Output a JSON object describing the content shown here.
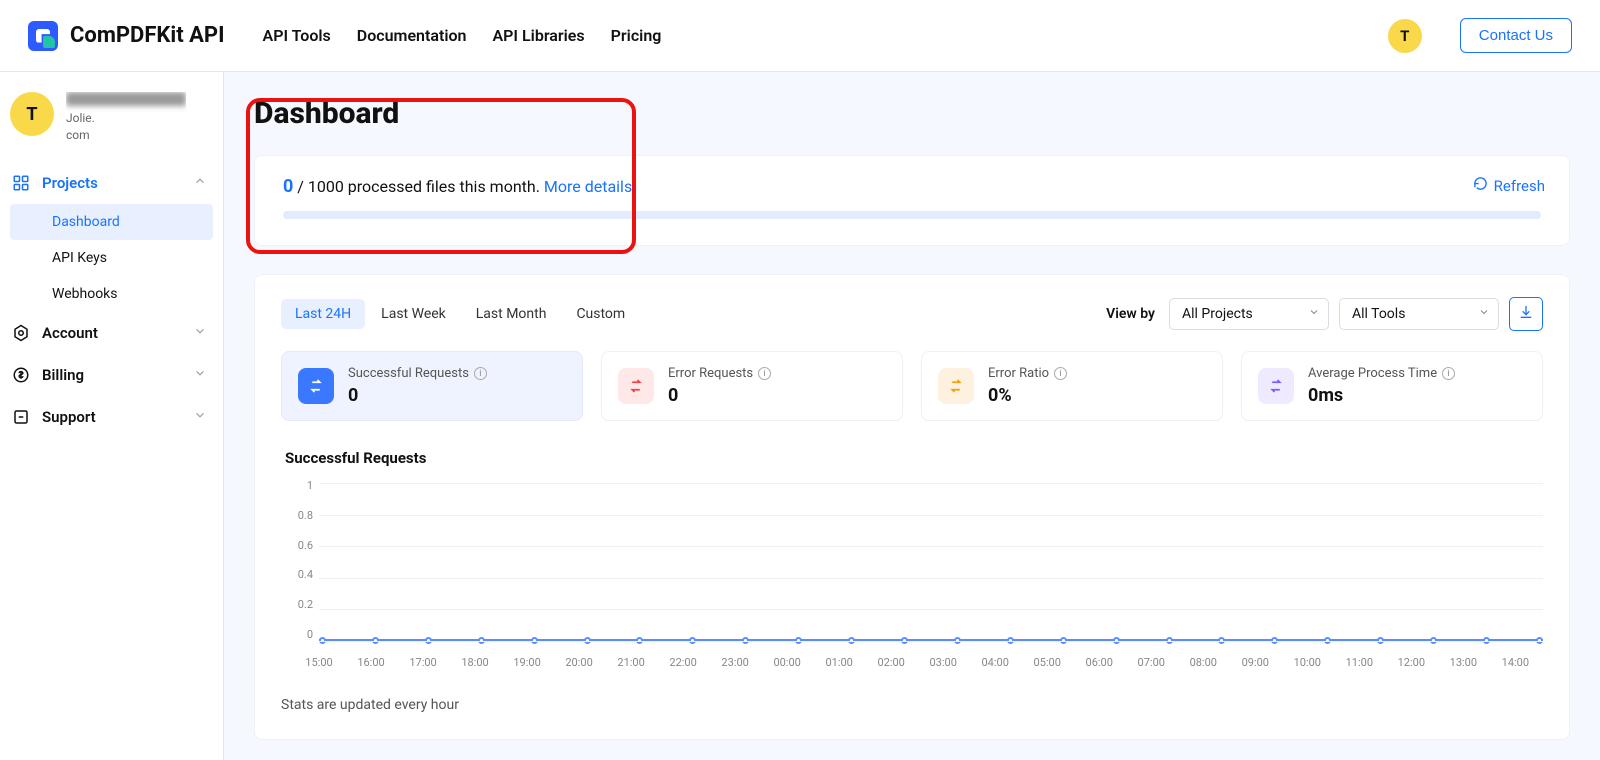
{
  "brand": "ComPDFKit API",
  "nav": {
    "api_tools": "API Tools",
    "documentation": "Documentation",
    "api_libraries": "API Libraries",
    "pricing": "Pricing",
    "contact": "Contact Us"
  },
  "avatar_letter": "T",
  "sidebar": {
    "user_line2": "  Jolie.",
    "user_line3": "com",
    "projects": {
      "label": "Projects",
      "items": [
        {
          "label": "Dashboard"
        },
        {
          "label": "API Keys"
        },
        {
          "label": "Webhooks"
        }
      ]
    },
    "account": {
      "label": "Account"
    },
    "billing": {
      "label": "Billing"
    },
    "support": {
      "label": "Support"
    }
  },
  "page": {
    "title": "Dashboard",
    "usage": {
      "processed": "0",
      "limit_text": " / 1000 processed files this month. ",
      "more_details": "More details",
      "refresh": "Refresh"
    },
    "range_tabs": [
      "Last 24H",
      "Last Week",
      "Last Month",
      "Custom"
    ],
    "active_range_index": 0,
    "view_by_label": "View by",
    "project_select": "All Projects",
    "tool_select": "All Tools",
    "metrics": [
      {
        "label": "Successful Requests",
        "value": "0"
      },
      {
        "label": "Error Requests",
        "value": "0"
      },
      {
        "label": "Error Ratio",
        "value": "0%"
      },
      {
        "label": "Average Process Time",
        "value": "0ms"
      }
    ],
    "chart_title": "Successful Requests",
    "chart_footer": "Stats are updated every hour"
  },
  "chart_data": {
    "type": "line",
    "title": "Successful Requests",
    "xlabel": "",
    "ylabel": "",
    "ylim": [
      0,
      1
    ],
    "yticks": [
      0,
      0.2,
      0.4,
      0.6,
      0.8,
      1
    ],
    "categories": [
      "15:00",
      "16:00",
      "17:00",
      "18:00",
      "19:00",
      "20:00",
      "21:00",
      "22:00",
      "23:00",
      "00:00",
      "01:00",
      "02:00",
      "03:00",
      "04:00",
      "05:00",
      "06:00",
      "07:00",
      "08:00",
      "09:00",
      "10:00",
      "11:00",
      "12:00",
      "13:00",
      "14:00"
    ],
    "series": [
      {
        "name": "Successful Requests",
        "values": [
          0,
          0,
          0,
          0,
          0,
          0,
          0,
          0,
          0,
          0,
          0,
          0,
          0,
          0,
          0,
          0,
          0,
          0,
          0,
          0,
          0,
          0,
          0,
          0
        ]
      }
    ]
  }
}
